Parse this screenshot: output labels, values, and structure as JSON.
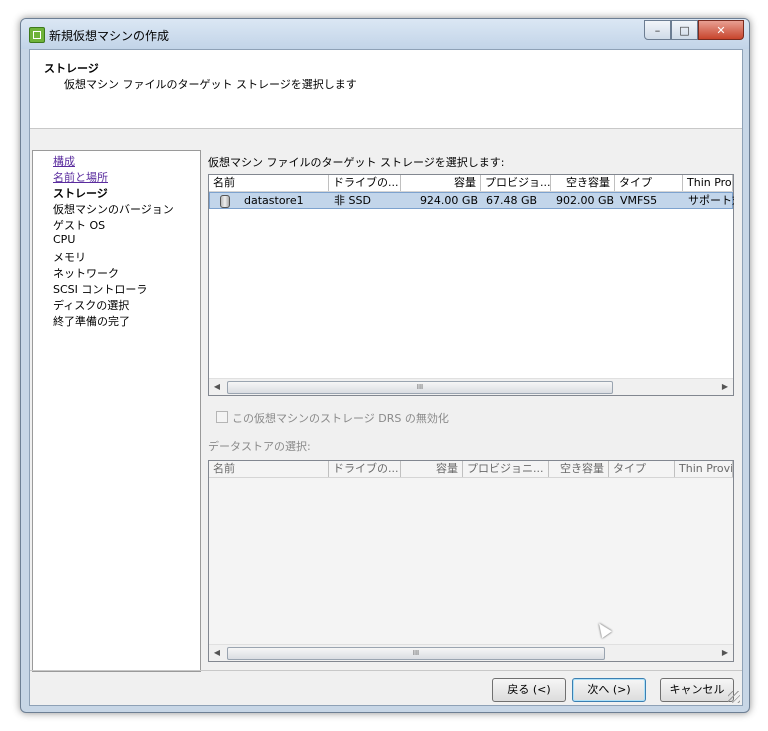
{
  "window": {
    "title": "新規仮想マシンの作成",
    "controls": [
      "minimize-icon",
      "maximize-icon",
      "close-icon"
    ]
  },
  "header": {
    "title": "ストレージ",
    "subtitle": "仮想マシン ファイルのターゲット ストレージを選択します"
  },
  "nav": {
    "items": [
      {
        "label": "構成",
        "state": "link"
      },
      {
        "label": "名前と場所",
        "state": "link"
      },
      {
        "label": "ストレージ",
        "state": "current"
      },
      {
        "label": "仮想マシンのバージョン",
        "state": "normal"
      },
      {
        "label": "ゲスト OS",
        "state": "normal"
      },
      {
        "label": "CPU",
        "state": "normal"
      },
      {
        "label": "メモリ",
        "state": "normal"
      },
      {
        "label": "ネットワーク",
        "state": "normal"
      },
      {
        "label": "SCSI コントローラ",
        "state": "normal"
      },
      {
        "label": "ディスクの選択",
        "state": "normal"
      },
      {
        "label": "終了準備の完了",
        "state": "normal"
      }
    ]
  },
  "storage": {
    "prompt": "仮想マシン ファイルのターゲット ストレージを選択します:",
    "columns": [
      "名前",
      "ドライブの...",
      "容量",
      "プロビジョ...",
      "空き容量",
      "タイプ",
      "Thin Prov"
    ],
    "rows": [
      {
        "name": "datastore1",
        "drive": "非 SSD",
        "capacity": "924.00 GB",
        "provisioned": "67.48 GB",
        "free": "902.00 GB",
        "type": "VMFS5",
        "thin": "サポート対"
      }
    ],
    "scroll_glyph": "III"
  },
  "drs": {
    "checkbox_label": "この仮想マシンのストレージ DRS の無効化",
    "checked": false
  },
  "datastore_select": {
    "label": "データストアの選択:",
    "columns": [
      "名前",
      "ドライブの...",
      "容量",
      "プロビジョニ...",
      "空き容量",
      "タイプ",
      "Thin Provi"
    ],
    "scroll_glyph": "III"
  },
  "buttons": {
    "back": "戻る (<)",
    "next": "次へ (>)",
    "cancel": "キャンセル"
  }
}
